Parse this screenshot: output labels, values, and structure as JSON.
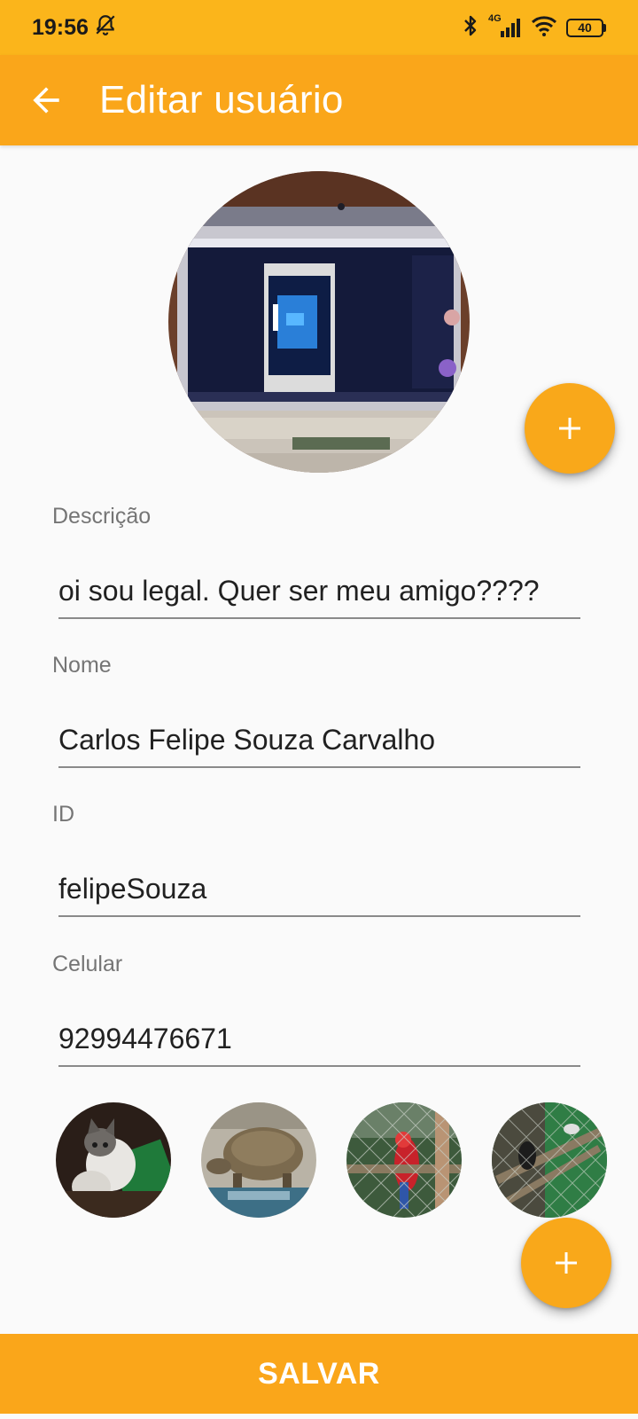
{
  "status_bar": {
    "time": "19:56",
    "network": "4G",
    "battery": "40",
    "icons": [
      "alarm-off-icon",
      "bluetooth-icon",
      "signal-icon",
      "wifi-icon",
      "battery-icon"
    ]
  },
  "app_bar": {
    "title": "Editar usuário",
    "back_icon": "arrow-back-icon"
  },
  "profile": {
    "photo": "profile-photo-laptop-screen",
    "add_icon": "plus-icon"
  },
  "fields": {
    "descricao": {
      "label": "Descrição",
      "value": "oi sou legal. Quer ser meu amigo????"
    },
    "nome": {
      "label": "Nome",
      "value": "Carlos Felipe Souza Carvalho"
    },
    "id": {
      "label": "ID",
      "value": "felipeSouza"
    },
    "celular": {
      "label": "Celular",
      "value": "92994476671"
    }
  },
  "gallery": {
    "items": [
      "photo-cat",
      "photo-tortoise",
      "photo-parrot",
      "photo-birds-aviary"
    ],
    "add_icon": "plus-icon"
  },
  "actions": {
    "save_label": "SALVAR"
  },
  "colors": {
    "status_bar": "#fbb51b",
    "primary": "#faa61a",
    "fab": "#f9a81a",
    "background": "#fafafa"
  }
}
